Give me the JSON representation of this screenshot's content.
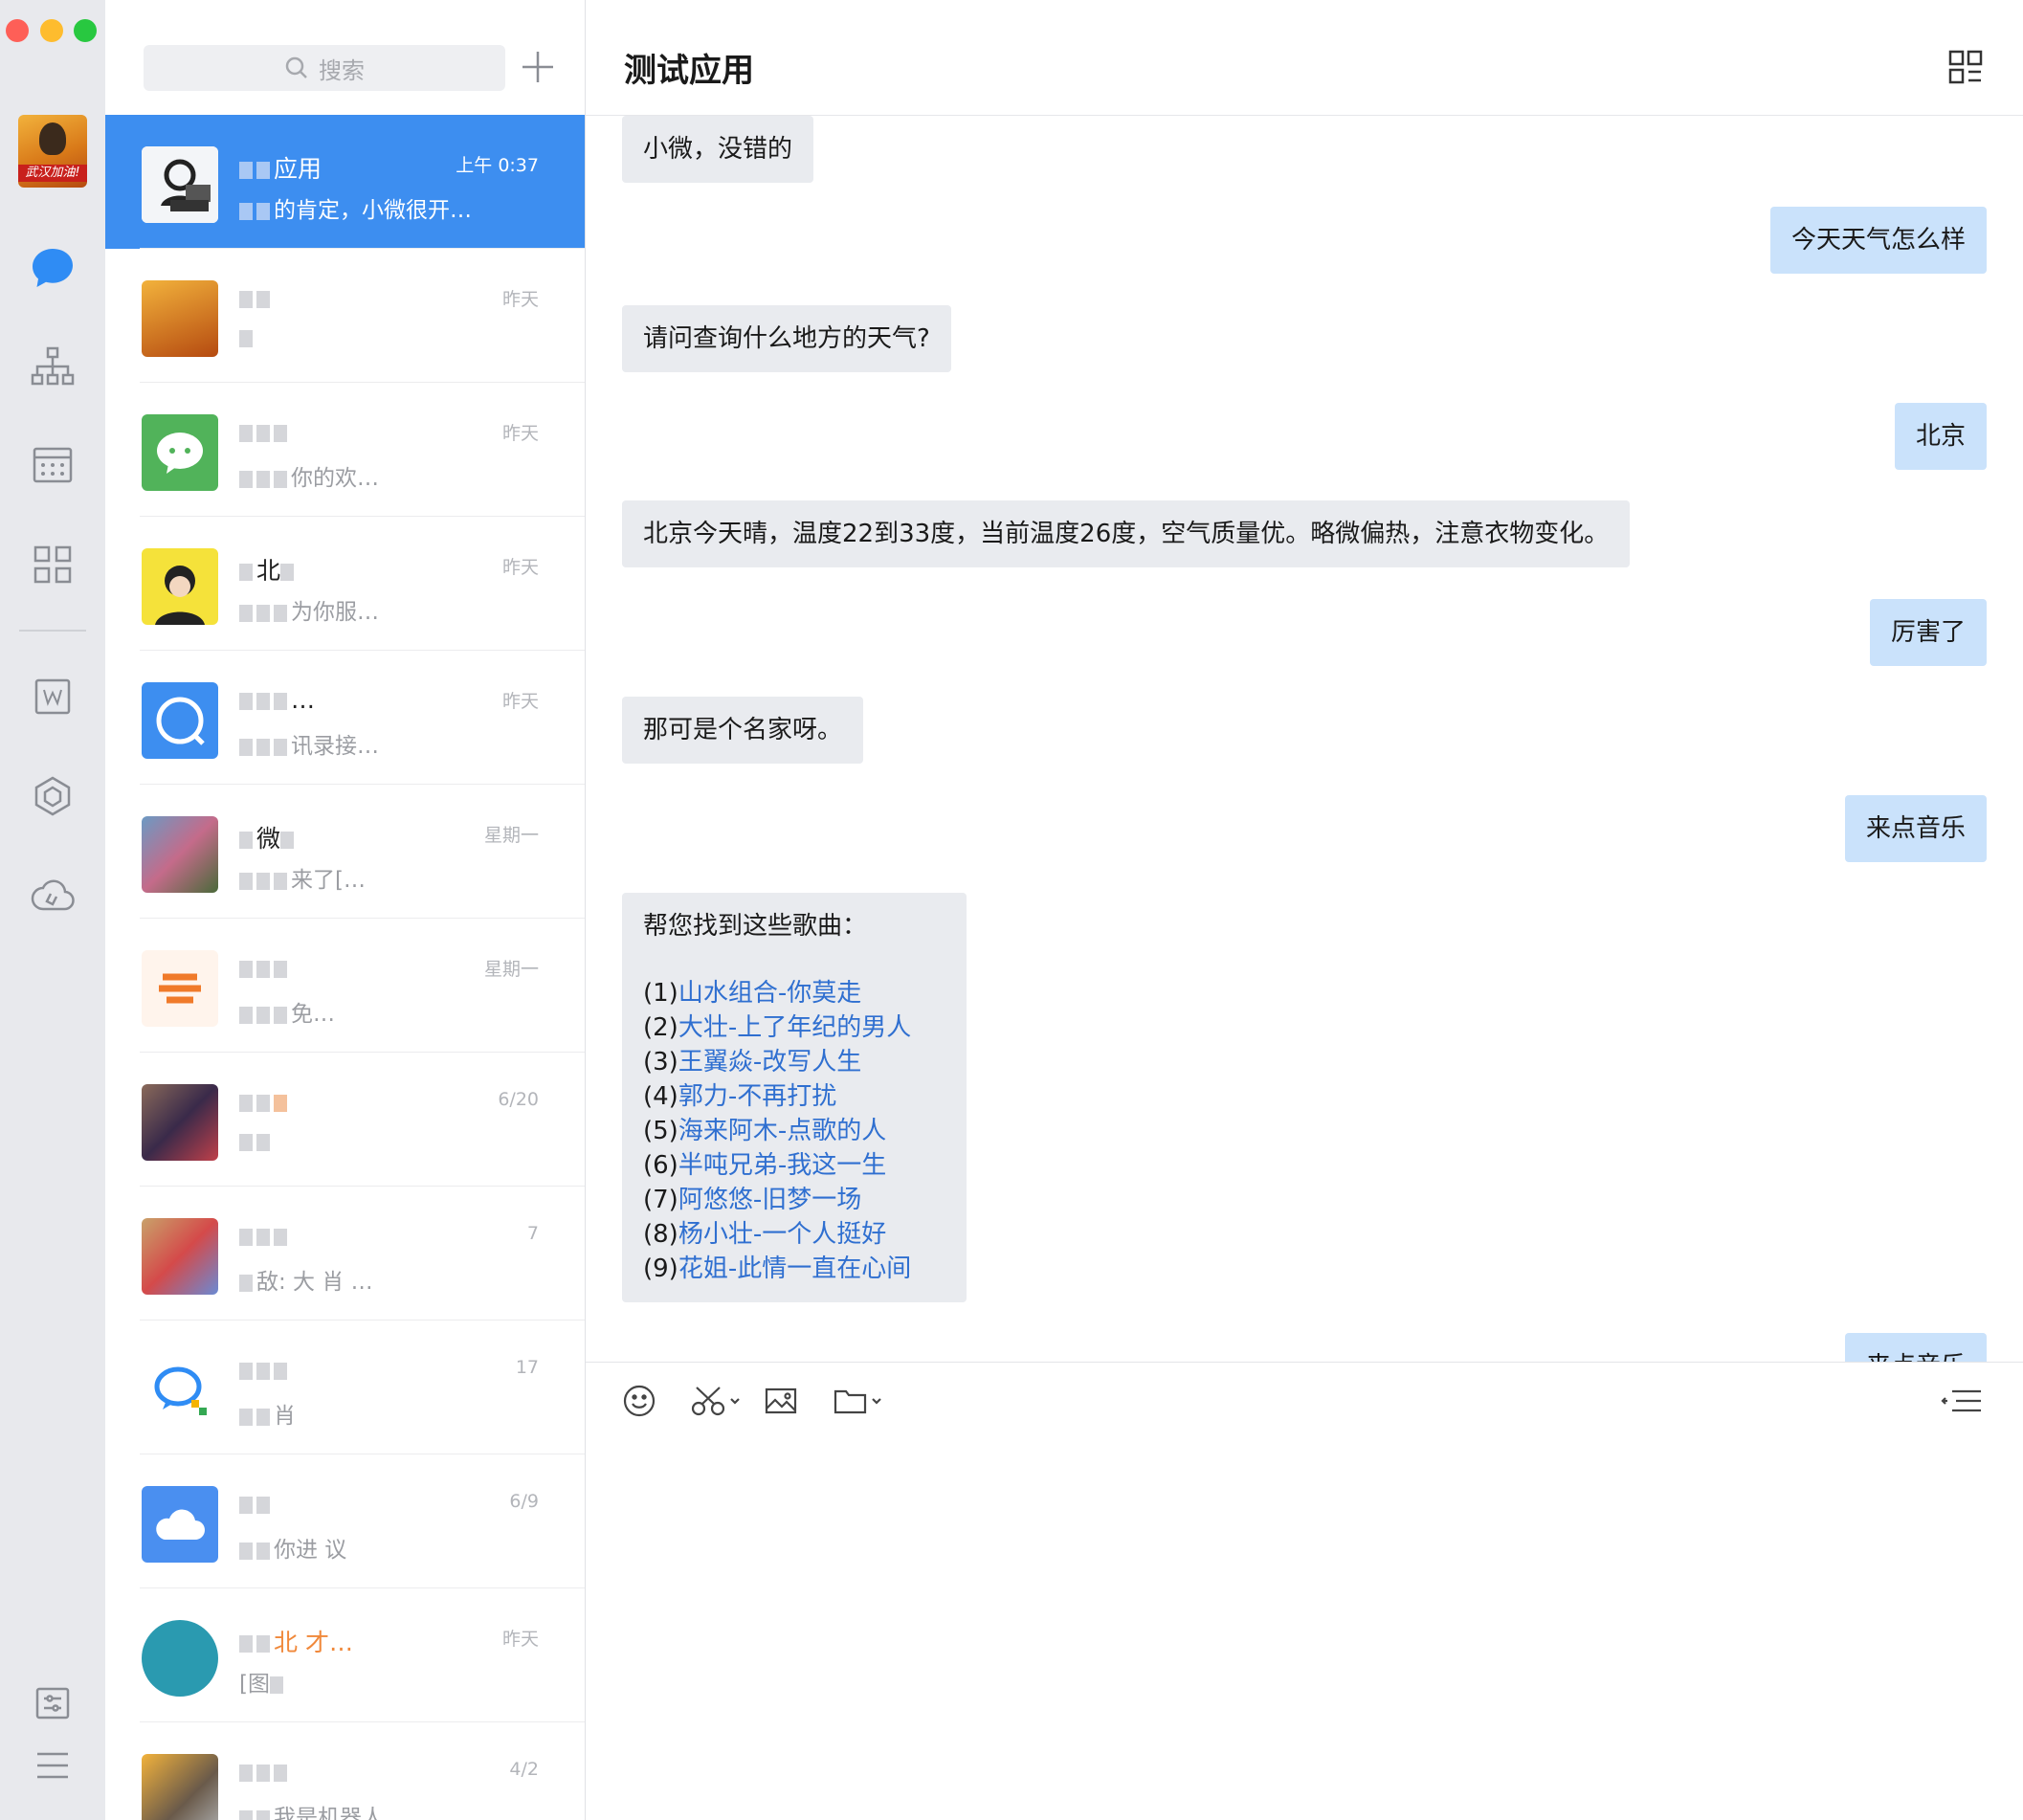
{
  "window": {
    "title": "测试应用"
  },
  "search": {
    "placeholder": "搜索"
  },
  "conversations": [
    {
      "name": "应用",
      "time": "上午 0:37",
      "preview": "的肯定，小微很开…",
      "active": true
    },
    {
      "name": "",
      "time": "昨天",
      "preview": ""
    },
    {
      "name": "",
      "time": "昨天",
      "preview": "你的欢…"
    },
    {
      "name": "北",
      "time": "昨天",
      "preview": "为你服…"
    },
    {
      "name": "…",
      "time": "昨天",
      "preview": "讯录接…"
    },
    {
      "name": "微",
      "time": "星期一",
      "preview": "来了[…"
    },
    {
      "name": "",
      "time": "星期一",
      "preview": "免…"
    },
    {
      "name": "",
      "time": "6/20",
      "preview": ""
    },
    {
      "name": "",
      "time": "7",
      "preview": "敌: 大 肖 …"
    },
    {
      "name": "",
      "time": "17",
      "preview": "肖"
    },
    {
      "name": "",
      "time": "6/9",
      "preview": "你进 议"
    },
    {
      "name": "北 才…",
      "time": "昨天",
      "preview": "[图"
    },
    {
      "name": "",
      "time": "4/2",
      "preview": "我是机器人…"
    }
  ],
  "messages": [
    {
      "side": "in",
      "text": "小微，没错的"
    },
    {
      "side": "out",
      "text": "今天天气怎么样"
    },
    {
      "side": "in",
      "text": "请问查询什么地方的天气?"
    },
    {
      "side": "out",
      "text": "北京"
    },
    {
      "side": "in",
      "text": "北京今天晴，温度22到33度，当前温度26度，空气质量优。略微偏热，注意衣物变化。"
    },
    {
      "side": "out",
      "text": "厉害了"
    },
    {
      "side": "in",
      "text": "那可是个名家呀。"
    },
    {
      "side": "out",
      "text": "来点音乐"
    },
    {
      "side": "in",
      "type": "music",
      "intro": "帮您找到这些歌曲：",
      "songs": [
        {
          "index": "(1)",
          "title": "山水组合-你莫走"
        },
        {
          "index": "(2)",
          "title": "大壮-上了年纪的男人"
        },
        {
          "index": "(3)",
          "title": "王翼焱-改写人生"
        },
        {
          "index": "(4)",
          "title": "郭力-不再打扰"
        },
        {
          "index": "(5)",
          "title": "海来阿木-点歌的人"
        },
        {
          "index": "(6)",
          "title": "半吨兄弟-我这一生"
        },
        {
          "index": "(7)",
          "title": "阿悠悠-旧梦一场"
        },
        {
          "index": "(8)",
          "title": "杨小壮-一个人挺好"
        },
        {
          "index": "(9)",
          "title": "花姐-此情一直在心间"
        }
      ]
    },
    {
      "side": "out",
      "text": "来点音乐"
    }
  ],
  "rail": {
    "avatar_tag": "武汉加油!"
  },
  "colors": {
    "accent": "#3d8ef0",
    "link": "#2f6fd0",
    "out_bubble": "#cae2fb",
    "in_bubble": "#e9ebef"
  },
  "icons": [
    "chat-icon",
    "org-icon",
    "calendar-icon",
    "apps-icon",
    "doc-icon",
    "cube-icon",
    "cloud-icon",
    "settings-icon",
    "menu-icon",
    "emoji-icon",
    "scissors-icon",
    "image-icon",
    "folder-icon",
    "send-mode-icon",
    "grid-icon",
    "search-icon",
    "plus-icon"
  ]
}
